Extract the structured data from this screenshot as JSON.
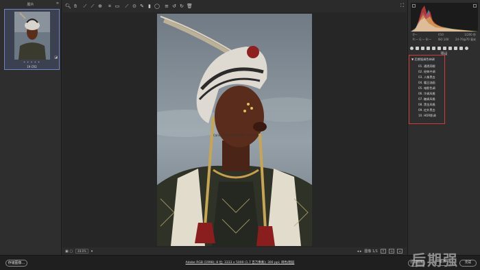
{
  "filmstrip": {
    "title": "胶片",
    "select_all_icon": "select-all-icon",
    "thumb": {
      "stars": "* * * * *",
      "name": "19 CR2"
    }
  },
  "toolbar": {
    "tools": [
      "zoom-tool-icon",
      "hand-tool-icon",
      "white-balance-icon",
      "color-sampler-icon",
      "targeted-adjust-icon",
      "crop-icon",
      "straighten-icon",
      "spot-removal-icon",
      "red-eye-icon",
      "adjustment-brush-icon",
      "graduated-filter-icon",
      "radial-filter-icon",
      "preferences-icon",
      "rotate-ccw-icon",
      "rotate-cw-icon",
      "trash-icon"
    ],
    "fullscreen_icon": "fullscreen-icon"
  },
  "canvas": {
    "caption": "Canon EOS 5D Mark IV - 19 CR2"
  },
  "status": {
    "zoom": "48.8%",
    "image_count": "图像 1/1"
  },
  "histogram": {
    "exif_row1_left": "f/—",
    "exif_row1_mid": "f/10",
    "exif_row1_right": "1/200 秒",
    "exif_row2_left": "R:— G:— B:—",
    "exif_row2_mid": "ISO 100",
    "exif_row2_right": "24-70@70 毫米"
  },
  "panel": {
    "title": "预设",
    "group": "▼ 后期强调色神调",
    "presets": [
      "01. 通透亮眼",
      "02. 经典中调",
      "03. 人像黑白",
      "04. 暖日油画",
      "05. 电影色调",
      "06. 冷调风格",
      "07. 糖调风格",
      "08. 黑金风格",
      "09. 红外黑白",
      "10. HDR影调"
    ]
  },
  "bottom": {
    "save_label": "存储图像...",
    "workflow_label": "Adobe RGB (1998); 8 位; 3333 x 5000 (1.7 百万像素); 300 ppi; 调色/图层",
    "open_label": "打开图像",
    "cancel_label": "取消",
    "done_label": "完成",
    "watermark": "后期强"
  },
  "colors": {
    "accent": "#6e86c4",
    "highlight_box": "#d43a3a"
  }
}
